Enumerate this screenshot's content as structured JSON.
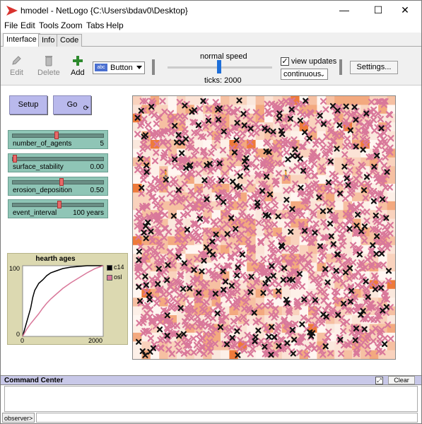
{
  "window": {
    "title": "hmodel - NetLogo {C:\\Users\\bdav0\\Desktop}",
    "minimize": "—",
    "maximize": "☐",
    "close": "✕"
  },
  "menu": [
    "File",
    "Edit",
    "Tools",
    "Zoom",
    "Tabs",
    "Help"
  ],
  "tabs": [
    "Interface",
    "Info",
    "Code"
  ],
  "toolbar": {
    "edit": "Edit",
    "delete": "Delete",
    "add": "Add",
    "widget_type": "Button",
    "speed_label": "normal speed",
    "speed_fraction": 0.5,
    "ticks": "ticks: 2000",
    "view_updates": "view updates",
    "view_updates_checked": true,
    "update_mode": "continuous",
    "settings": "Settings..."
  },
  "buttons": {
    "setup": "Setup",
    "go": "Go"
  },
  "sliders": [
    {
      "name": "number_of_agents",
      "value": "5",
      "fraction": 0.48
    },
    {
      "name": "surface_stability",
      "value": "0.00",
      "fraction": 0.0
    },
    {
      "name": "erosion_deposition",
      "value": "0.50",
      "fraction": 0.54
    },
    {
      "name": "event_interval",
      "value": "100 years",
      "fraction": 0.52
    }
  ],
  "plot": {
    "title": "hearth ages",
    "ymax_label": "100",
    "ymin_label": "0",
    "xmin_label": "0",
    "xmax_label": "2000",
    "legend": [
      {
        "name": "c14",
        "color": "#000000"
      },
      {
        "name": "osl",
        "color": "#d9789a"
      }
    ]
  },
  "chart_data": {
    "type": "line",
    "title": "hearth ages",
    "xlim": [
      0,
      2000
    ],
    "ylim": [
      0,
      100
    ],
    "series": [
      {
        "name": "c14",
        "color": "#000000",
        "x": [
          0,
          100,
          200,
          250,
          300,
          400,
          500,
          600,
          700,
          800,
          900,
          1000,
          1100,
          1200,
          1400,
          1600,
          1800,
          2000
        ],
        "y": [
          0,
          20,
          40,
          55,
          65,
          75,
          80,
          86,
          90,
          92,
          94,
          96,
          97,
          98,
          99,
          100,
          100,
          100
        ]
      },
      {
        "name": "osl",
        "color": "#d9789a",
        "x": [
          0,
          100,
          200,
          300,
          400,
          500,
          600,
          700,
          800,
          900,
          1000,
          1200,
          1400,
          1600,
          1800,
          2000
        ],
        "y": [
          0,
          10,
          18,
          25,
          32,
          40,
          47,
          53,
          58,
          63,
          68,
          76,
          83,
          90,
          96,
          100
        ]
      }
    ]
  },
  "command_center": {
    "title": "Command Center",
    "clear": "Clear",
    "prompt": "observer>"
  },
  "colors": {
    "button_bg": "#b9b9ec",
    "slider_bg": "#8fc5b6",
    "plot_bg": "#dcd9b1",
    "accent_red": "#d9322e"
  }
}
